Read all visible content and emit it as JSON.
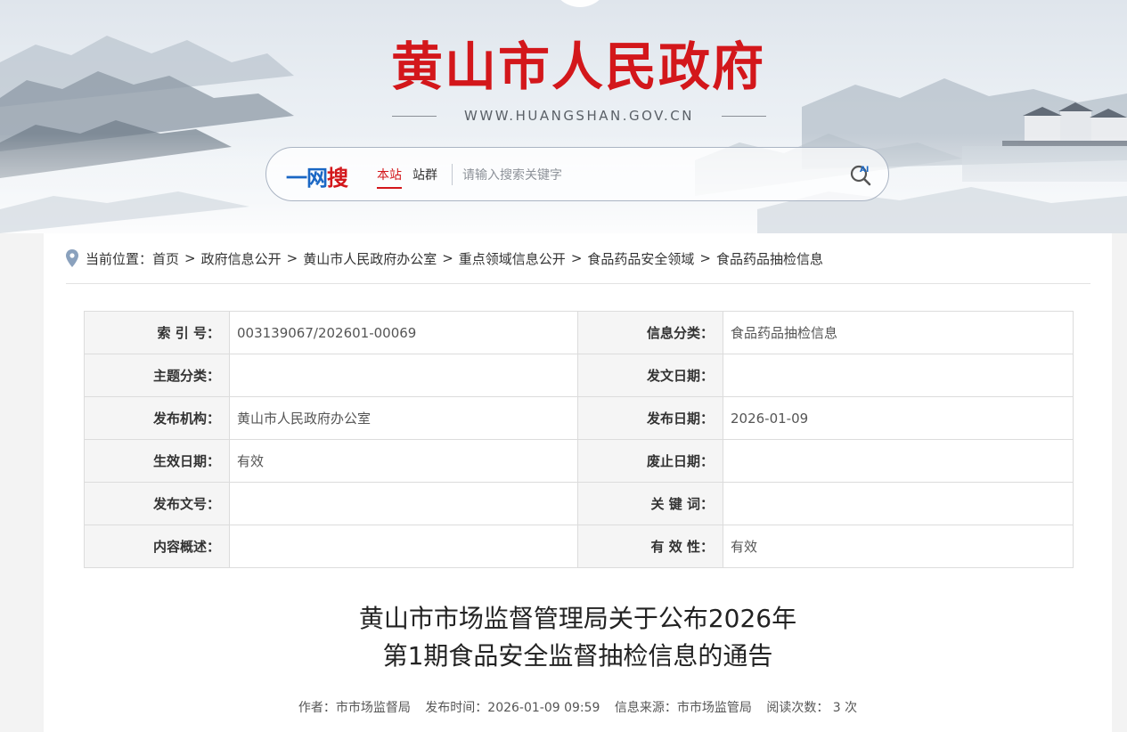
{
  "header": {
    "site_title": "黄山市人民政府",
    "site_url": "WWW.HUANGSHAN.GOV.CN",
    "search": {
      "brand_part1": "一网",
      "brand_part2": "搜",
      "scope_this_site": "本站",
      "scope_site_group": "站群",
      "placeholder": "请输入搜索关键字",
      "ai_icon": "ai-search-icon"
    }
  },
  "breadcrumb": {
    "prefix": "当前位置：",
    "items": [
      "首页",
      "政府信息公开",
      "黄山市人民政府办公室",
      "重点领域信息公开",
      "食品药品安全领域",
      "食品药品抽检信息"
    ],
    "separator": ">"
  },
  "meta_table": {
    "rows": [
      {
        "label1": "索 引 号：",
        "value1": "003139067/202601-00069",
        "label2": "信息分类：",
        "value2": "食品药品抽检信息"
      },
      {
        "label1": "主题分类：",
        "value1": "",
        "label2": "发文日期：",
        "value2": ""
      },
      {
        "label1": "发布机构：",
        "value1": "黄山市人民政府办公室",
        "label2": "发布日期：",
        "value2": "2026-01-09"
      },
      {
        "label1": "生效日期：",
        "value1": "有效",
        "label2": "废止日期：",
        "value2": ""
      },
      {
        "label1": "发布文号：",
        "value1": "",
        "label2": "关 键 词：",
        "value2": ""
      },
      {
        "label1": "内容概述：",
        "value1": "",
        "label2": "有 效 性：",
        "value2": "有效"
      }
    ]
  },
  "article": {
    "title_line1": "黄山市市场监督管理局关于公布2026年",
    "title_line2": "第1期食品安全监督抽检信息的通告",
    "author": "作者：市市场监督局",
    "publish_time": "发布时间：2026-01-09 09:59",
    "source": "信息来源：市市场监管局",
    "read_count": "阅读次数： 3 次"
  },
  "colors": {
    "brand_red": "#d3171b",
    "brand_blue": "#1a67c4",
    "page_bg": "#f3f3f3"
  }
}
